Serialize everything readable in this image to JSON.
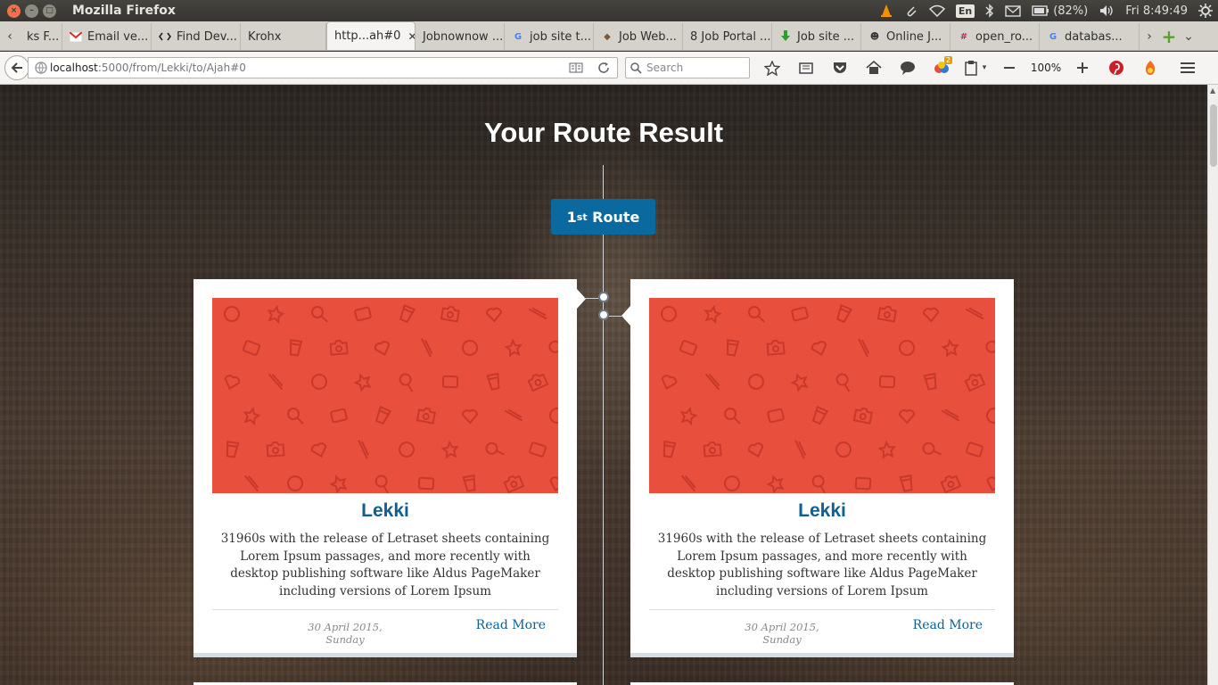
{
  "os_panel": {
    "window_title": "Mozilla Firefox",
    "battery": "(82%)",
    "language": "En",
    "clock": "Fri  8:49:49"
  },
  "tabs": [
    {
      "label": "ks F...",
      "icon": "partial-favicon"
    },
    {
      "label": "Email ve...",
      "icon": "gmail-icon"
    },
    {
      "label": "Find Dev...",
      "icon": "code-icon"
    },
    {
      "label": "Krohx",
      "icon": ""
    },
    {
      "label": "http...ah#0",
      "icon": "",
      "active": true
    },
    {
      "label": "Jobnownow ...",
      "icon": ""
    },
    {
      "label": "job site t...",
      "icon": "google-icon"
    },
    {
      "label": "Job Web...",
      "icon": "site-icon"
    },
    {
      "label": "8 Job Portal ...",
      "icon": ""
    },
    {
      "label": "Job site ...",
      "icon": "download-icon"
    },
    {
      "label": "Online J...",
      "icon": "site-icon"
    },
    {
      "label": "open_ro...",
      "icon": "slack-icon"
    },
    {
      "label": "databas...",
      "icon": "google-icon"
    }
  ],
  "navbar": {
    "url_host": "localhost",
    "url_path": ":5000/from/Lekki/to/Ajah#0",
    "search_placeholder": "Search",
    "zoom": "100%",
    "badge_count": "2"
  },
  "page": {
    "title": "Your Route Result",
    "route_button": {
      "ordinal": "1",
      "suffix": "st",
      "label": " Route"
    },
    "cards": [
      {
        "title": "Lekki",
        "text": "31960s with the release of Letraset sheets containing Lorem Ipsum passages, and more recently with desktop publishing software like Aldus PageMaker including versions of Lorem Ipsum",
        "date": "30 April 2015, Sunday",
        "link": "Read More"
      },
      {
        "title": "Lekki",
        "text": "31960s with the release of Letraset sheets containing Lorem Ipsum passages, and more recently with desktop publishing software like Aldus PageMaker including versions of Lorem Ipsum",
        "date": "30 April 2015, Sunday",
        "link": "Read More"
      }
    ]
  },
  "colors": {
    "accent": "#0a6aa0",
    "card_title": "#0f5f93",
    "pattern_bg": "#e84f3d",
    "pattern_line": "#c8392b"
  }
}
